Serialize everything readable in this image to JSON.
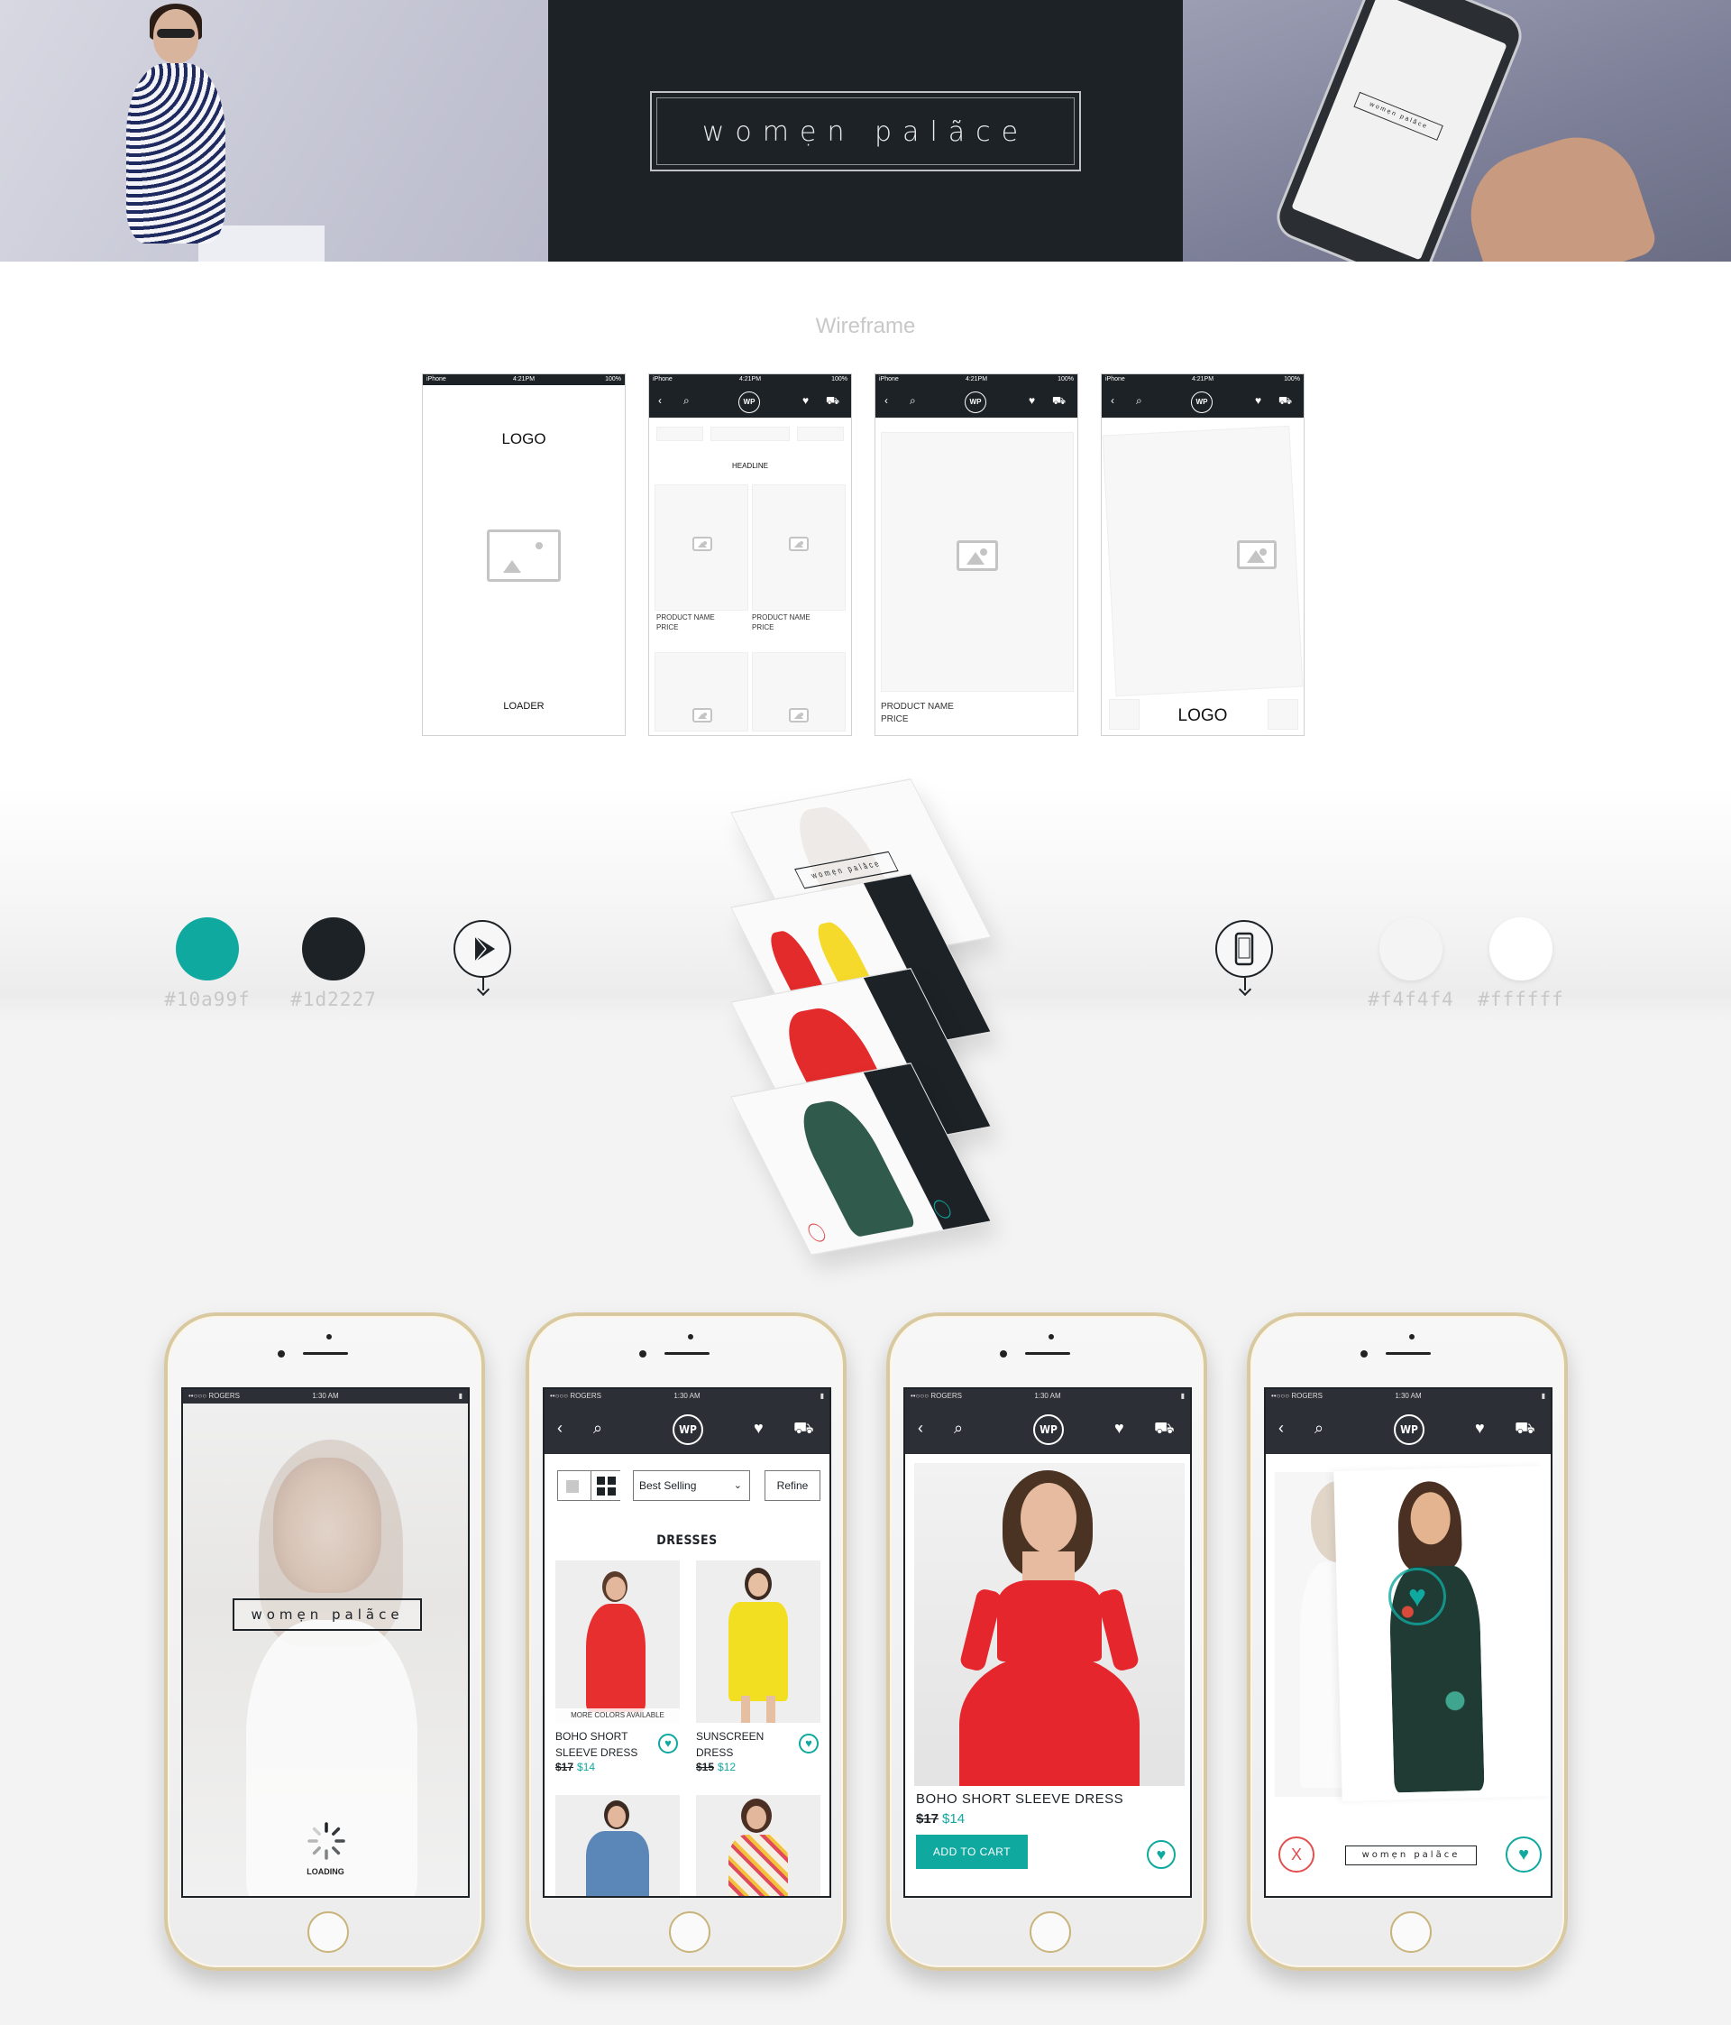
{
  "hero": {
    "brand_logo": "womẹn palãce"
  },
  "wireframe": {
    "section_title": "Wireframe",
    "status_carrier": "iPhone",
    "status_time": "4:21PM",
    "status_battery": "100%",
    "nav_logo": "WP",
    "splash_logo": "LOGO",
    "splash_loader": "LOADER",
    "grid_headline": "HEADLINE",
    "product_name": "PRODUCT NAME",
    "product_price": "PRICE",
    "swipe_logo": "LOGO"
  },
  "palette": {
    "colors": [
      {
        "hex": "#10a99f",
        "label": "#10a99f"
      },
      {
        "hex": "#1d2227",
        "label": "#1d2227"
      },
      {
        "hex": "#f4f4f4",
        "label": "#f4f4f4"
      },
      {
        "hex": "#ffffff",
        "label": "#ffffff"
      }
    ],
    "platforms": [
      "google-play-icon",
      "iphone-icon"
    ]
  },
  "phones": {
    "status": {
      "carrier": "••○○○ ROGERS",
      "time": "1:30 AM"
    },
    "nav_logo": "WP",
    "splash": {
      "logo": "womẹn palãce",
      "loading": "LOADING"
    },
    "listing": {
      "sort": "Best Selling",
      "refine": "Refine",
      "heading": "DRESSES",
      "more_colors": "MORE COLORS AVAILABLE",
      "products": [
        {
          "name": "BOHO SHORT SLEEVE DRESS",
          "old_price": "$17",
          "new_price": "$14"
        },
        {
          "name": "SUNSCREEN DRESS",
          "old_price": "$15",
          "new_price": "$12"
        }
      ]
    },
    "detail": {
      "name": "BOHO SHORT SLEEVE DRESS",
      "old_price": "$17",
      "new_price": "$14",
      "add_to_cart": "ADD TO CART"
    },
    "swipe": {
      "logo": "womẹn palãce",
      "dislike": "X"
    }
  },
  "accent": "#10a99f",
  "dark": "#1d2227"
}
